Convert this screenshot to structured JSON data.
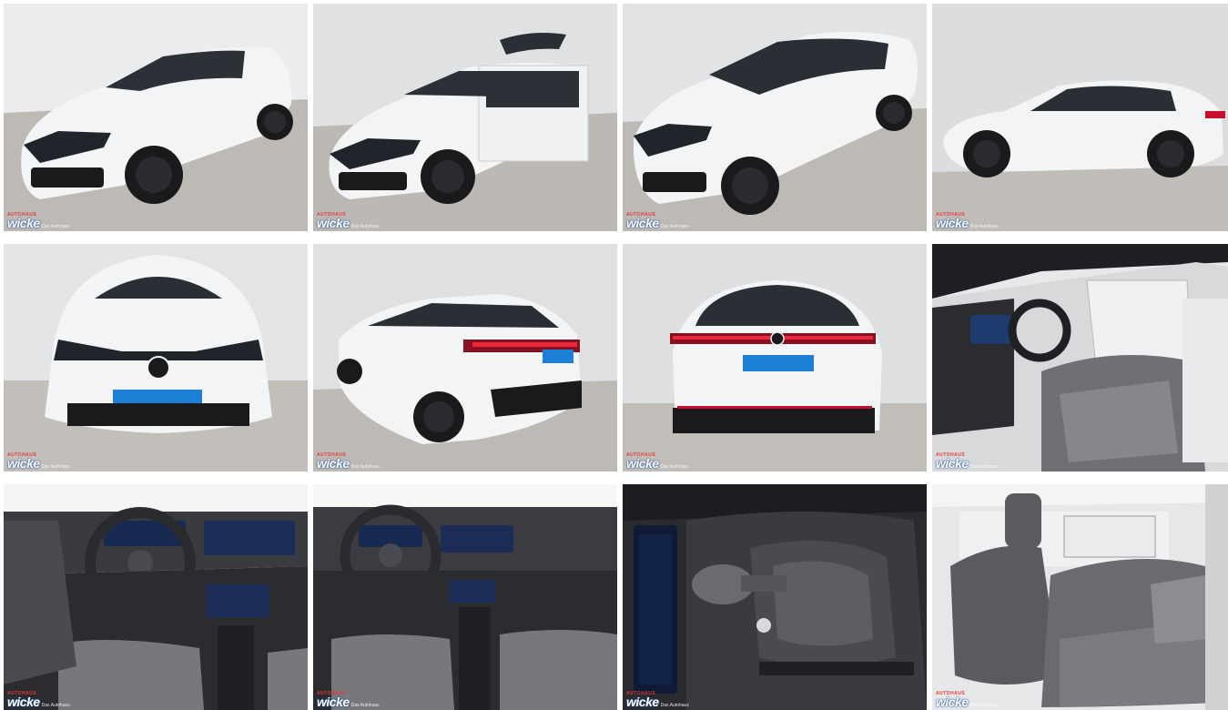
{
  "watermark": {
    "prefix": "AUTOHAUS",
    "brand": "wicke",
    "suffix": "Das Autohaus"
  },
  "photos": [
    {
      "id": "front-left",
      "icon": "car-front-left"
    },
    {
      "id": "front-left-door-open",
      "icon": "car-doors-open"
    },
    {
      "id": "front-left-high",
      "icon": "car-front-left-high"
    },
    {
      "id": "side",
      "icon": "car-side"
    },
    {
      "id": "front",
      "icon": "car-front"
    },
    {
      "id": "rear-left",
      "icon": "car-rear-left"
    },
    {
      "id": "rear",
      "icon": "car-rear"
    },
    {
      "id": "interior-driver",
      "icon": "car-interior-driver"
    },
    {
      "id": "cockpit",
      "icon": "car-cockpit"
    },
    {
      "id": "cockpit-2",
      "icon": "car-cockpit"
    },
    {
      "id": "gear-shifter",
      "icon": "gear-shifter"
    },
    {
      "id": "rear-seats",
      "icon": "car-rear-seats"
    }
  ],
  "colors": {
    "car_white": "#f4f5f6",
    "showroom_wall": "#dfe0e2",
    "floor": "#bfbbb5",
    "tyre": "#1b1b1d",
    "light_bar": "#c8102e",
    "plate_blue": "#1e7fd6",
    "interior_dark": "#2b2c30",
    "seat_grey": "#6f7074"
  }
}
